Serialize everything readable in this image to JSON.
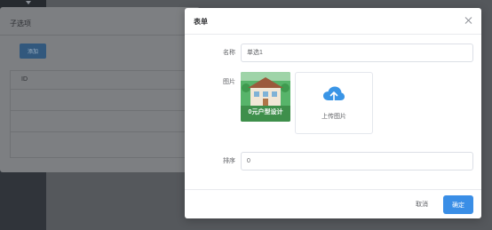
{
  "background": {
    "dialog_title": "子选项",
    "add_button": "添加",
    "table": {
      "columns": [
        "ID"
      ]
    }
  },
  "dialog": {
    "title": "表单",
    "fields": {
      "name_label": "名称",
      "name_value": "单选1",
      "image_label": "图片",
      "image_caption": "0元户型设计",
      "upload_label": "上传图片",
      "order_label": "排序",
      "order_value": "0"
    },
    "footer": {
      "cancel": "取消",
      "confirm": "确定"
    }
  },
  "colors": {
    "primary": "#3a8ee6",
    "thumb_bg": "#57b46a",
    "upload_icon": "#3a95e6"
  }
}
